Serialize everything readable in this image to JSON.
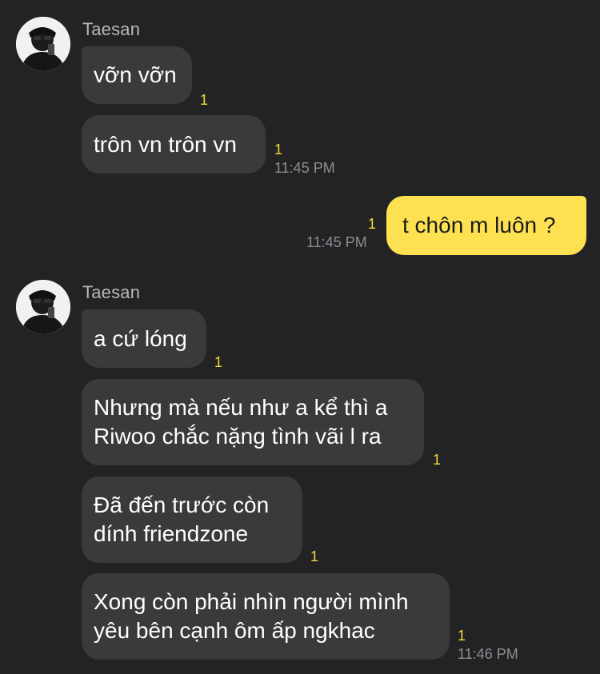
{
  "groups": [
    {
      "sender": "Taesan",
      "messages": [
        {
          "text": "vỡn vỡn",
          "unread": "1",
          "time": ""
        },
        {
          "text": "trôn vn trôn vn",
          "unread": "1",
          "time": "11:45 PM"
        }
      ]
    },
    {
      "mine": true,
      "messages": [
        {
          "text": "t chôn m luôn ?",
          "unread": "1",
          "time": "11:45 PM"
        }
      ]
    },
    {
      "sender": "Taesan",
      "messages": [
        {
          "text": "a cứ lóng",
          "unread": "1",
          "time": ""
        },
        {
          "lines": [
            "Nhưng mà nếu như a kể thì a",
            "Riwoo chắc nặng tình vãi l ra"
          ],
          "unread": "1",
          "time": ""
        },
        {
          "lines": [
            "Đã đến trước còn",
            "dính friendzone"
          ],
          "unread": "1",
          "time": ""
        },
        {
          "lines": [
            "Xong còn phải nhìn người mình",
            "yêu bên cạnh ôm ấp ngkhac"
          ],
          "unread": "1",
          "time": "11:46 PM"
        }
      ]
    }
  ],
  "colors": {
    "background": "#232325",
    "incoming_bubble": "#3a3a3c",
    "outgoing_bubble": "#fde151",
    "unread_count": "#f6d83a",
    "timestamp": "#8e8e92"
  },
  "icons": {
    "avatar": "profile-photo"
  }
}
